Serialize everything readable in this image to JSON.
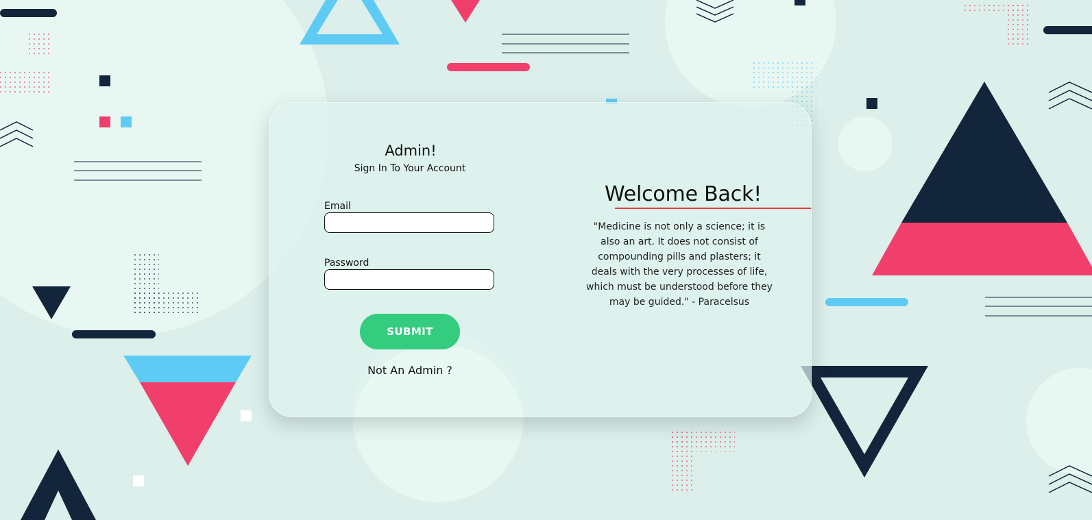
{
  "login": {
    "title": "Admin!",
    "subtitle": "Sign In To Your Account",
    "email_label": "Email",
    "email_value": "",
    "email_placeholder": "",
    "password_label": "Password",
    "password_value": "",
    "password_placeholder": "",
    "submit_label": "SUBMIT",
    "not_admin_label": "Not An Admin ?"
  },
  "welcome": {
    "title": "Welcome Back!",
    "quote": "\"Medicine is not only a science; it is also an art. It does not consist of compounding pills and plasters; it deals with the very processes of life, which must be understood before they may be guided.\" - Paracelsus"
  },
  "colors": {
    "background": "#dcefeb",
    "navy": "#13253a",
    "pink": "#f13f6c",
    "sky_blue": "#5ecbf5",
    "submit_green": "#34cc7f",
    "welcome_underline": "#e53935"
  },
  "decorative_shapes": [
    "triangle-outline-blue",
    "triangle-pink",
    "triangle-navy",
    "triangle-navy-pink-split",
    "inverted-triangle-blue-pink-split",
    "inverted-triangle-outline-navy",
    "circle-light",
    "dot-grid",
    "chevrons",
    "parallel-lines",
    "rounded-bar",
    "small-square"
  ]
}
